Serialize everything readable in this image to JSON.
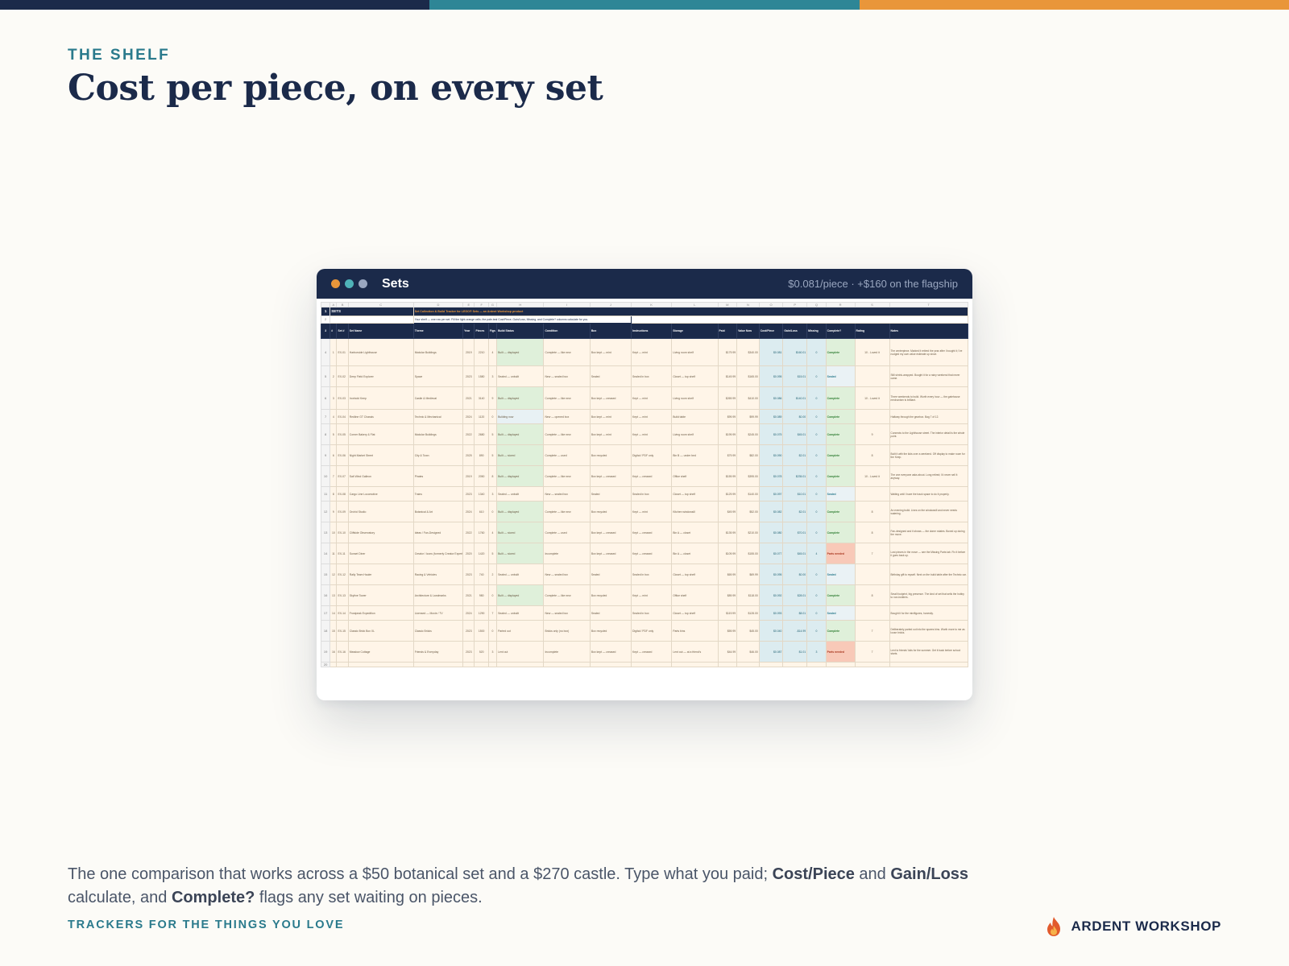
{
  "top_stripe_colors": [
    "#1B2A4A",
    "#2E8696",
    "#E9963A"
  ],
  "eyebrow": "THE SHELF",
  "title": "Cost per piece, on every set",
  "window": {
    "dots": [
      "#E9963A",
      "#4FB3B8",
      "#9AA7C0"
    ],
    "title": "Sets",
    "meta": "$0.081/piece · +$160 on the flagship"
  },
  "sheet": {
    "col_letters": [
      "A",
      "B",
      "C",
      "D",
      "E",
      "F",
      "G",
      "H",
      "I",
      "J",
      "K",
      "L",
      "M",
      "N",
      "O",
      "P",
      "Q",
      "R",
      "S",
      "T"
    ],
    "banner_title": "SETS",
    "banner_subtitle": "Set Collection & Build Tracker for LEGO® Sets — an Ardent Workshop product",
    "note": "Your shelf — one row per set. Fill the light-orange cells; the pale-teal Cost/Piece, Gain/Loss, Missing, and Complete? columns calculate for you.",
    "headers": [
      "#",
      "Set #",
      "Set Name",
      "Theme",
      "Year",
      "Pieces",
      "Figs",
      "Build Status",
      "Condition",
      "Box",
      "Instructions",
      "Storage",
      "Paid",
      "Value Now",
      "Cost/Piece",
      "Gain/Loss",
      "Missing",
      "Complete?",
      "Rating",
      "Notes"
    ],
    "rows": [
      {
        "n": "1",
        "id": "EX-01",
        "name": "Harborside Lighthouse",
        "theme": "Modular Buildings",
        "year": "2019",
        "pieces": "2210",
        "figs": "4",
        "status": "Built — displayed",
        "cond": "Complete — like new",
        "box": "Box kept — mint",
        "instr": "Kept — mint",
        "storage": "Living room shelf",
        "paid": "$179.99",
        "value": "$340.00",
        "cpp": "$0.081",
        "gl": "$160.01",
        "miss": "0",
        "comp": "Complete",
        "rating": "10 - Loved it",
        "notes": "The centerpiece. Marked it retired the year after I bought it; I've nudged my own value estimate up since."
      },
      {
        "n": "2",
        "id": "EX-02",
        "name": "Deep Field Explorer",
        "theme": "Space",
        "year": "2023",
        "pieces": "1580",
        "figs": "3",
        "status": "Sealed — unbuilt",
        "cond": "New — sealed box",
        "box": "Sealed",
        "instr": "Sealed in box",
        "storage": "Closet — top shelf",
        "paid": "$149.99",
        "value": "$165.00",
        "cpp": "$0.095",
        "gl": "$15.01",
        "miss": "0",
        "comp": "Sealed",
        "rating": "",
        "notes": "Still shrink-wrapped. Bought it for a rainy weekend that never came."
      },
      {
        "n": "3",
        "id": "EX-03",
        "name": "Ironhold Keep",
        "theme": "Castle & Medieval",
        "year": "2021",
        "pieces": "3140",
        "figs": "9",
        "status": "Built — displayed",
        "cond": "Complete — like new",
        "box": "Box kept — creased",
        "instr": "Kept — mint",
        "storage": "Living room shelf",
        "paid": "$269.99",
        "value": "$410.00",
        "cpp": "$0.086",
        "gl": "$140.01",
        "miss": "0",
        "comp": "Complete",
        "rating": "10 - Loved it",
        "notes": "Three weekends to build. Worth every hour — the gatehouse mechanism is brilliant."
      },
      {
        "n": "4",
        "id": "EX-04",
        "name": "Redline GT Chassis",
        "theme": "Technic & Mechanical",
        "year": "2024",
        "pieces": "1120",
        "figs": "0",
        "status": "Building now",
        "cond": "New — opened box",
        "box": "Box kept — mint",
        "instr": "Kept — mint",
        "storage": "Build table",
        "paid": "$99.99",
        "value": "$99.99",
        "cpp": "$0.089",
        "gl": "$0.00",
        "miss": "0",
        "comp": "Complete",
        "rating": "",
        "notes": "Halfway through the gearbox. Bag 7 of 12."
      },
      {
        "n": "5",
        "id": "EX-05",
        "name": "Corner Bakery & Flat",
        "theme": "Modular Buildings",
        "year": "2022",
        "pieces": "2680",
        "figs": "5",
        "status": "Built — displayed",
        "cond": "Complete — like new",
        "box": "Box kept — mint",
        "instr": "Kept — mint",
        "storage": "Living room shelf",
        "paid": "$199.99",
        "value": "$245.00",
        "cpp": "$0.075",
        "gl": "$45.01",
        "miss": "0",
        "comp": "Complete",
        "rating": "9",
        "notes": "Connects to the Lighthouse street. The interior detail is the whole point."
      },
      {
        "n": "6",
        "id": "EX-06",
        "name": "Night Market Street",
        "theme": "City & Town",
        "year": "2025",
        "pieces": "890",
        "figs": "5",
        "status": "Built — stored",
        "cond": "Complete — used",
        "box": "Box recycled",
        "instr": "Digital / PDF only",
        "storage": "Bin B — under bed",
        "paid": "$79.99",
        "value": "$82.00",
        "cpp": "$0.090",
        "gl": "$2.01",
        "miss": "0",
        "comp": "Complete",
        "rating": "8",
        "notes": "Built it with the kids over a weekend. Off display to make room for the Keep."
      },
      {
        "n": "7",
        "id": "EX-07",
        "name": "Salt Wind Galleon",
        "theme": "Pirates",
        "year": "2019",
        "pieces": "2050",
        "figs": "8",
        "status": "Built — displayed",
        "cond": "Complete — like new",
        "box": "Box kept — creased",
        "instr": "Kept — creased",
        "storage": "Office shelf",
        "paid": "$159.99",
        "value": "$395.00",
        "cpp": "$0.078",
        "gl": "$235.01",
        "miss": "0",
        "comp": "Complete",
        "rating": "10 - Loved it",
        "notes": "The one everyone asks about. Long retired; I'd never sell it anyway."
      },
      {
        "n": "8",
        "id": "EX-08",
        "name": "Cargo Line Locomotive",
        "theme": "Trains",
        "year": "2023",
        "pieces": "1340",
        "figs": "3",
        "status": "Sealed — unbuilt",
        "cond": "New — sealed box",
        "box": "Sealed",
        "instr": "Sealed in box",
        "storage": "Closet — top shelf",
        "paid": "$129.99",
        "value": "$140.00",
        "cpp": "$0.097",
        "gl": "$10.01",
        "miss": "0",
        "comp": "Sealed",
        "rating": "",
        "notes": "Waiting until I have the track space to do it properly."
      },
      {
        "n": "9",
        "id": "EX-09",
        "name": "Orchid Studio",
        "theme": "Botanical & Art",
        "year": "2024",
        "pieces": "610",
        "figs": "0",
        "status": "Built — displayed",
        "cond": "Complete — like new",
        "box": "Box recycled",
        "instr": "Kept — mint",
        "storage": "Kitchen windowsill",
        "paid": "$49.99",
        "value": "$52.00",
        "cpp": "$0.082",
        "gl": "$2.01",
        "miss": "0",
        "comp": "Complete",
        "rating": "8",
        "notes": "An evening build. Lives on the windowsill and never needs watering."
      },
      {
        "n": "10",
        "id": "EX-10",
        "name": "Cliffside Observatory",
        "theme": "Ideas / Fan-Designed",
        "year": "2022",
        "pieces": "1760",
        "figs": "4",
        "status": "Built — stored",
        "cond": "Complete — used",
        "box": "Box kept — creased",
        "instr": "Kept — creased",
        "storage": "Bin A — closet",
        "paid": "$139.99",
        "value": "$210.00",
        "cpp": "$0.080",
        "gl": "$70.01",
        "miss": "0",
        "comp": "Complete",
        "rating": "8",
        "notes": "Fan-designed and it shows — the dome rotates. Boxed up during the move."
      },
      {
        "n": "11",
        "id": "EX-11",
        "name": "Sunset Diner",
        "theme": "Creator / Icons (formerly Creator Expert)",
        "year": "2020",
        "pieces": "1420",
        "figs": "5",
        "status": "Built — stored",
        "cond": "Incomplete",
        "box": "Box kept — creased",
        "instr": "Kept — creased",
        "storage": "Bin A — closet",
        "paid": "$109.99",
        "value": "$155.00",
        "cpp": "$0.077",
        "gl": "$45.01",
        "miss": "4",
        "comp": "Parts needed",
        "rating": "7",
        "notes": "Lost pieces in the move — see the Missing Parts tab. Fix it before it goes back up."
      },
      {
        "n": "12",
        "id": "EX-12",
        "name": "Rally Team Hauler",
        "theme": "Racing & Vehicles",
        "year": "2023",
        "pieces": "740",
        "figs": "2",
        "status": "Sealed — unbuilt",
        "cond": "New — sealed box",
        "box": "Sealed",
        "instr": "Sealed in box",
        "storage": "Closet — top shelf",
        "paid": "$69.99",
        "value": "$69.99",
        "cpp": "$0.095",
        "gl": "$0.00",
        "miss": "0",
        "comp": "Sealed",
        "rating": "",
        "notes": "Birthday gift to myself. Next on the build table after the Technic car."
      },
      {
        "n": "13",
        "id": "EX-13",
        "name": "Skyline Tower",
        "theme": "Architecture & Landmarks",
        "year": "2021",
        "pieces": "980",
        "figs": "0",
        "status": "Built — displayed",
        "cond": "Complete — like new",
        "box": "Box recycled",
        "instr": "Kept — mint",
        "storage": "Office shelf",
        "paid": "$89.99",
        "value": "$118.00",
        "cpp": "$0.092",
        "gl": "$28.01",
        "miss": "0",
        "comp": "Complete",
        "rating": "8",
        "notes": "Small footprint, big presence. The kind of set that sells the hobby to non-builders."
      },
      {
        "n": "14",
        "id": "EX-14",
        "name": "Frostpeak Expedition",
        "theme": "Licensed — Movie / TV",
        "year": "2024",
        "pieces": "1290",
        "figs": "7",
        "status": "Sealed — unbuilt",
        "cond": "New — sealed box",
        "box": "Sealed",
        "instr": "Sealed in box",
        "storage": "Closet — top shelf",
        "paid": "$119.99",
        "value": "$128.00",
        "cpp": "$0.093",
        "gl": "$8.01",
        "miss": "0",
        "comp": "Sealed",
        "rating": "",
        "notes": "Bought it for the minifigures, honestly."
      },
      {
        "n": "15",
        "id": "EX-15",
        "name": "Classic Brick Box XL",
        "theme": "Classic Bricks",
        "year": "2023",
        "pieces": "1500",
        "figs": "0",
        "status": "Parted out",
        "cond": "Bricks only (no box)",
        "box": "Box recycled",
        "instr": "Digital / PDF only",
        "storage": "Parts bins",
        "paid": "$59.99",
        "value": "$45.00",
        "cpp": "$0.040",
        "gl": "-$14.99",
        "miss": "0",
        "comp": "Complete",
        "rating": "7",
        "notes": "Deliberately parted out into the spares bins. Worth more to me as loose bricks."
      },
      {
        "n": "16",
        "id": "EX-16",
        "name": "Meadow Cottage",
        "theme": "Friends & Everyday",
        "year": "2023",
        "pieces": "520",
        "figs": "3",
        "status": "Lent out",
        "cond": "Incomplete",
        "box": "Box kept — creased",
        "instr": "Kept — creased",
        "storage": "Lent out — at a friend's",
        "paid": "$44.99",
        "value": "$46.00",
        "cpp": "$0.087",
        "gl": "$1.01",
        "miss": "3",
        "comp": "Parts needed",
        "rating": "7",
        "notes": "Lent to friends' kids for the summer. Get it back before school starts."
      }
    ]
  },
  "description": {
    "p1": "The one comparison that works across a $50 botanical set and a $270 castle. Type what you paid; ",
    "b1": "Cost/Piece",
    "p2": " and ",
    "b2": "Gain/Loss",
    "p3": " calculate, and ",
    "b3": "Complete?",
    "p4": " flags any set waiting on pieces."
  },
  "tagline": "TRACKERS FOR THE THINGS YOU LOVE",
  "brand": {
    "name": "ARDENT WORKSHOP",
    "icon": "flame-icon"
  }
}
